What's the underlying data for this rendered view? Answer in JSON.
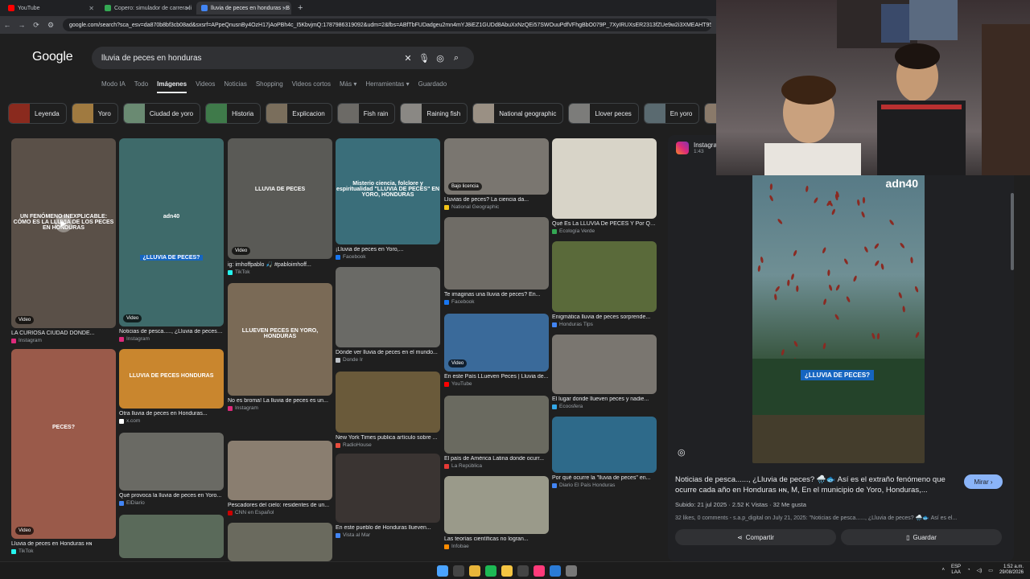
{
  "browser": {
    "tabs": [
      {
        "label": "YouTube",
        "color": "#ff0000"
      },
      {
        "label": "Copero: simulador de carrera li",
        "color": "#34a853"
      },
      {
        "label": "lluvia de peces en honduras - B",
        "color": "#4285f4"
      }
    ],
    "url": "google.com/search?sca_esv=da870b8bf3cb08ad&sxsrf=APpeQnusnBy4OzH17jAoPBh4c_I5KbvjmQ:1787986319092&udm=2&fbs=ABfTbFUDadgeu2mn4mYJ8iEZ1GUDd8AbuXxNzQEi57SWOuuPdfVFhgBbO079P_7XyIRUXsER2313fZUe9w2i3XMEAHT953rISF8ZY5gaZ"
  },
  "google": {
    "logo": "Google",
    "query": "lluvia de peces en honduras",
    "tabs": [
      "Modo IA",
      "Todo",
      "Imágenes",
      "Videos",
      "Noticias",
      "Shopping",
      "Videos cortos",
      "Más ▾",
      "Herramientas ▾",
      "Guardado"
    ],
    "active_tab": "Imágenes"
  },
  "chips": [
    {
      "label": "Leyenda",
      "color": "#8a2a1e"
    },
    {
      "label": "Yoro",
      "color": "#a07a40"
    },
    {
      "label": "Ciudad de yoro",
      "color": "#6a8a72"
    },
    {
      "label": "Historia",
      "color": "#3f7a4a"
    },
    {
      "label": "Explicacion",
      "color": "#7a6e5c"
    },
    {
      "label": "Fish rain",
      "color": "#6c6a66"
    },
    {
      "label": "Raining fish",
      "color": "#8a8884"
    },
    {
      "label": "National geographic",
      "color": "#9a9084"
    },
    {
      "label": "Llover peces",
      "color": "#7c7c7a"
    },
    {
      "label": "En yoro",
      "color": "#5a6a70"
    },
    {
      "label": "",
      "color": "#8a7a6a"
    }
  ],
  "results": [
    {
      "caption": "LA CURIOSA CIUDAD DONDE...",
      "source": "Instagram",
      "src_color": "#dd2a7b",
      "overlay": "UN FENÓMENO INEXPLICABLE: CÓMO ES LA LLUVIA DE LOS PECES EN HONDURAS",
      "badge": "Video"
    },
    {
      "caption": "Noticias de pesca....., ¿Lluvia de peces?...",
      "source": "Instagram",
      "src_color": "#dd2a7b",
      "overlay": "adn40",
      "subtitle": "¿LLUVIA DE PECES?",
      "badge": "Video"
    },
    {
      "caption": "ig: imhoffpablo 🎣 #pabloimhoff...",
      "source": "TikTok",
      "src_color": "#25f4ee",
      "overlay": "LLUVIA DE PECES",
      "badge": "Video"
    },
    {
      "caption": "¡Lluvia de peces en Yoro,...",
      "source": "Facebook",
      "src_color": "#1877f2",
      "overlay": "Misterio ciencia, folclore y espiritualidad \"LLUVIA DE PECES\" EN YORO, HONDURAS"
    },
    {
      "caption": "Lluvias de peces? La ciencia da...",
      "source": "National Geographic",
      "src_color": "#f5c518",
      "badge": "Bajo licencia"
    },
    {
      "caption": "Qué Es La LLUVIA De PECES Y Por Qué...",
      "source": "Ecología Verde",
      "src_color": "#34a853"
    },
    {
      "caption": "Lluvia de peces en Honduras ʜɴ",
      "source": "TikTok",
      "src_color": "#25f4ee",
      "overlay": "PECES?",
      "badge": "Video"
    },
    {
      "caption": "Otra lluvia de peces en Honduras...",
      "source": "x.com",
      "src_color": "#ffffff",
      "overlay": "LLUVIA DE PECES HONDURAS"
    },
    {
      "caption": "No es broma! La lluvia de peces es un...",
      "source": "Instagram",
      "src_color": "#dd2a7b",
      "overlay": "LLUEVEN PECES EN YORO, HONDURAS"
    },
    {
      "caption": "Dónde ver lluvia de peces en el mundo...",
      "source": "Donde Ir",
      "src_color": "#bdc1c6"
    },
    {
      "caption": "Te imaginas una lluvia de peces? En...",
      "source": "Facebook",
      "src_color": "#1877f2"
    },
    {
      "caption": "Enigmática lluvia de peces sorprende...",
      "source": "Honduras Tips",
      "src_color": "#4285f4"
    },
    {
      "caption": "Qué provoca la lluvia de peces en Yoro...",
      "source": "ElDiario",
      "src_color": "#4285f4"
    },
    {
      "caption": "Pescadores del cielo: residentes de un...",
      "source": "CNN en Español",
      "src_color": "#cc0000"
    },
    {
      "caption": "New York Times publica artículo sobre ...",
      "source": "RadioHouse",
      "src_color": "#e84c3d"
    },
    {
      "caption": "En este País LLueven Peces | Lluvia de...",
      "source": "YouTube",
      "src_color": "#ff0000",
      "badge": "Video"
    },
    {
      "caption": "El lugar donde llueven peces y nadie...",
      "source": "Ecoosfera",
      "src_color": "#34a8e8"
    },
    {
      "caption": "En este pueblo de Honduras llueven...",
      "source": "Vista al Mar",
      "src_color": "#4285f4"
    },
    {
      "caption": "El país de América Latina donde ocurr...",
      "source": "La República",
      "src_color": "#e53935"
    },
    {
      "caption": "Por qué ocurre la \"lluvia de peces\" en...",
      "source": "Diario El País Honduras",
      "src_color": "#4285f4"
    },
    {
      "caption": "Las teorías científicas no logran...",
      "source": "Infobae",
      "src_color": "#ff8c00"
    },
    {
      "caption": "",
      "source": "",
      "src_color": "#9aa0a6"
    },
    {
      "caption": "",
      "source": "",
      "src_color": "#9aa0a6"
    },
    {
      "caption": "",
      "source": "",
      "src_color": "#9aa0a6"
    }
  ],
  "preview": {
    "source": "Instagram",
    "duration": "1:43",
    "logo": "adn40",
    "subtitle": "¿LLUVIA DE PECES?",
    "title": "Noticias de pesca......, ¿Lluvia de peces? 🌧️🐟 Así es el extraño fenómeno que ocurre cada año en Honduras ʜɴ, M, En el municipio de Yoro, Honduras,...",
    "mirar": "Mirar ›",
    "meta": "Subido: 21 jul 2025 · 2.52 K Vistas · 32 Me gusta",
    "description": "32 likes, 0 comments - s.a.p_digital on July 21, 2025: \"Noticias de pesca......, ¿Lluvia de peces? 🌧️🐟 Así es el...",
    "share": "Compartir",
    "save": "Guardar"
  },
  "taskbar": {
    "lang": "ESP",
    "lang2": "LAA",
    "time": "1:52 a.m.",
    "date": "29/08/2026"
  }
}
